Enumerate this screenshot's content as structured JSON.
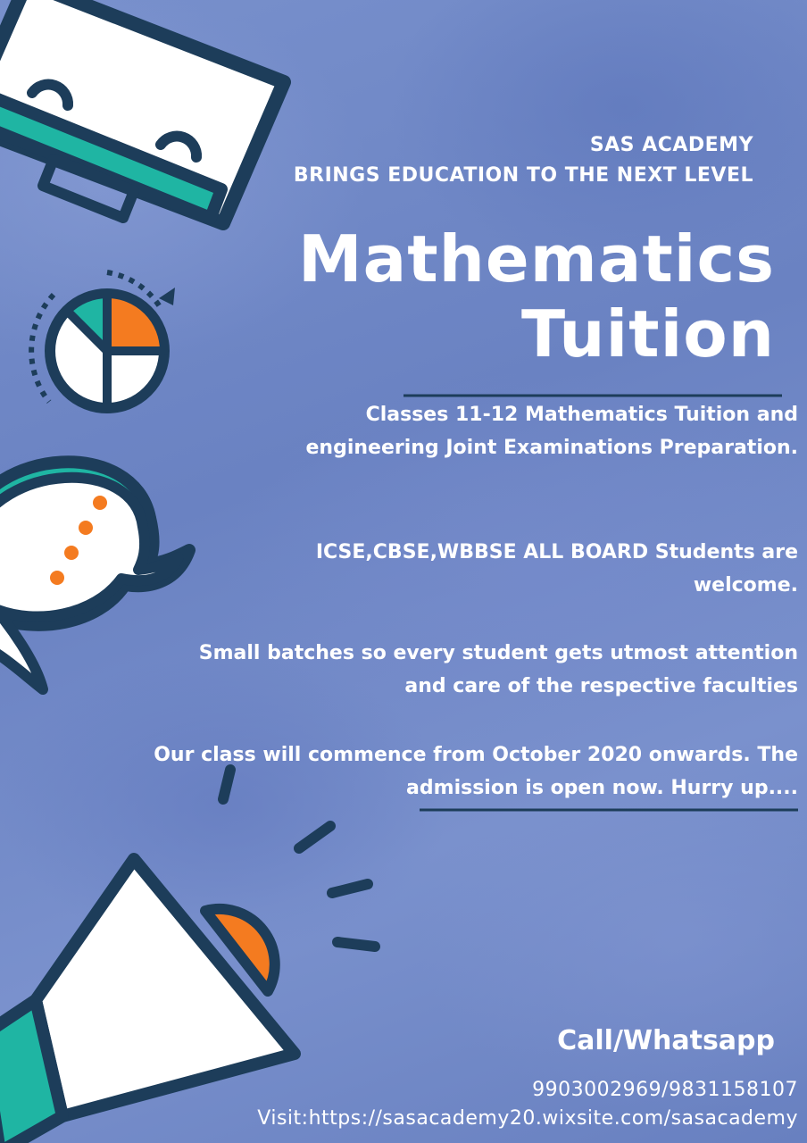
{
  "header": {
    "brand": "SAS ACADEMY",
    "tagline": "BRINGS EDUCATION TO THE NEXT LEVEL"
  },
  "title": {
    "line1": "Mathematics",
    "line2": "Tuition"
  },
  "paragraphs": {
    "classes": "Classes 11-12 Mathematics Tuition and engineering Joint Examinations Preparation.",
    "boards": "ICSE,CBSE,WBBSE ALL BOARD Students are welcome.",
    "batches": "Small batches so every student gets utmost attention and care of the respective faculties",
    "commence": "Our class will commence from October 2020 onwards. The admission is open now. Hurry up...."
  },
  "contact": {
    "label": "Call/Whatsapp",
    "phones": "9903002969/9831158107",
    "visit": "Visit:https://sasacademy20.wixsite.com/sasacademy"
  },
  "colors": {
    "background": "#6f87c4",
    "navy": "#1d3d5a",
    "teal": "#1fb5a3",
    "orange": "#f47b20",
    "white": "#ffffff"
  },
  "icons": [
    "presentation-board-icon",
    "pie-chart-icon",
    "speech-bubble-icon",
    "megaphone-icon"
  ]
}
